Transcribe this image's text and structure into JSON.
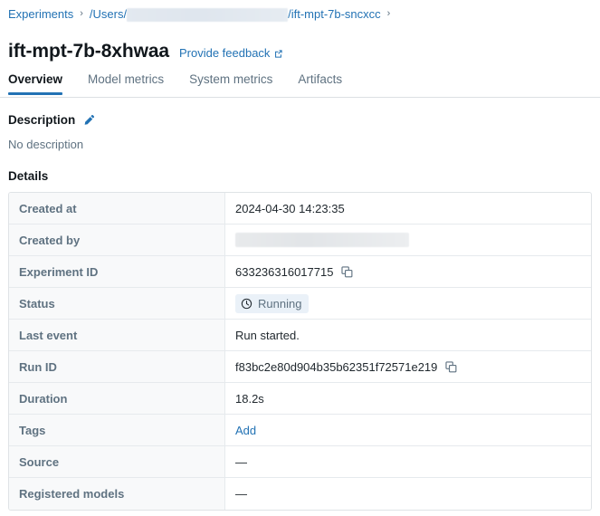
{
  "breadcrumb": {
    "root": "Experiments",
    "separator": "›",
    "users_prefix": "/Users/",
    "redacted": true,
    "path_suffix": "/ift-mpt-7b-sncxcc",
    "trailing_separator": "›"
  },
  "header": {
    "title": "ift-mpt-7b-8xhwaa",
    "feedback_label": "Provide feedback",
    "feedback_icon": "external-link-icon"
  },
  "tabs": [
    {
      "label": "Overview",
      "active": true
    },
    {
      "label": "Model metrics",
      "active": false
    },
    {
      "label": "System metrics",
      "active": false
    },
    {
      "label": "Artifacts",
      "active": false
    }
  ],
  "description": {
    "heading": "Description",
    "edit_icon": "pencil-icon",
    "body": "No description"
  },
  "details": {
    "heading": "Details",
    "rows": [
      {
        "key": "Created at",
        "value": "2024-04-30 14:23:35",
        "type": "text"
      },
      {
        "key": "Created by",
        "value": "",
        "type": "redacted"
      },
      {
        "key": "Experiment ID",
        "value": "633236316017715",
        "type": "copyable"
      },
      {
        "key": "Status",
        "value": "Running",
        "type": "status"
      },
      {
        "key": "Last event",
        "value": "Run started.",
        "type": "text"
      },
      {
        "key": "Run ID",
        "value": "f83bc2e80d904b35b62351f72571e219",
        "type": "copyable"
      },
      {
        "key": "Duration",
        "value": "18.2s",
        "type": "text"
      },
      {
        "key": "Tags",
        "value": "Add",
        "type": "link"
      },
      {
        "key": "Source",
        "value": "—",
        "type": "text"
      },
      {
        "key": "Registered models",
        "value": "—",
        "type": "text"
      }
    ]
  },
  "colors": {
    "link": "#2272b4",
    "accent_underline": "#2272b4",
    "muted_text": "#5f7281",
    "text": "#11171c",
    "border": "#e6eaed",
    "key_bg": "#f8f9fa",
    "status_badge_bg": "#eaf1f8"
  }
}
